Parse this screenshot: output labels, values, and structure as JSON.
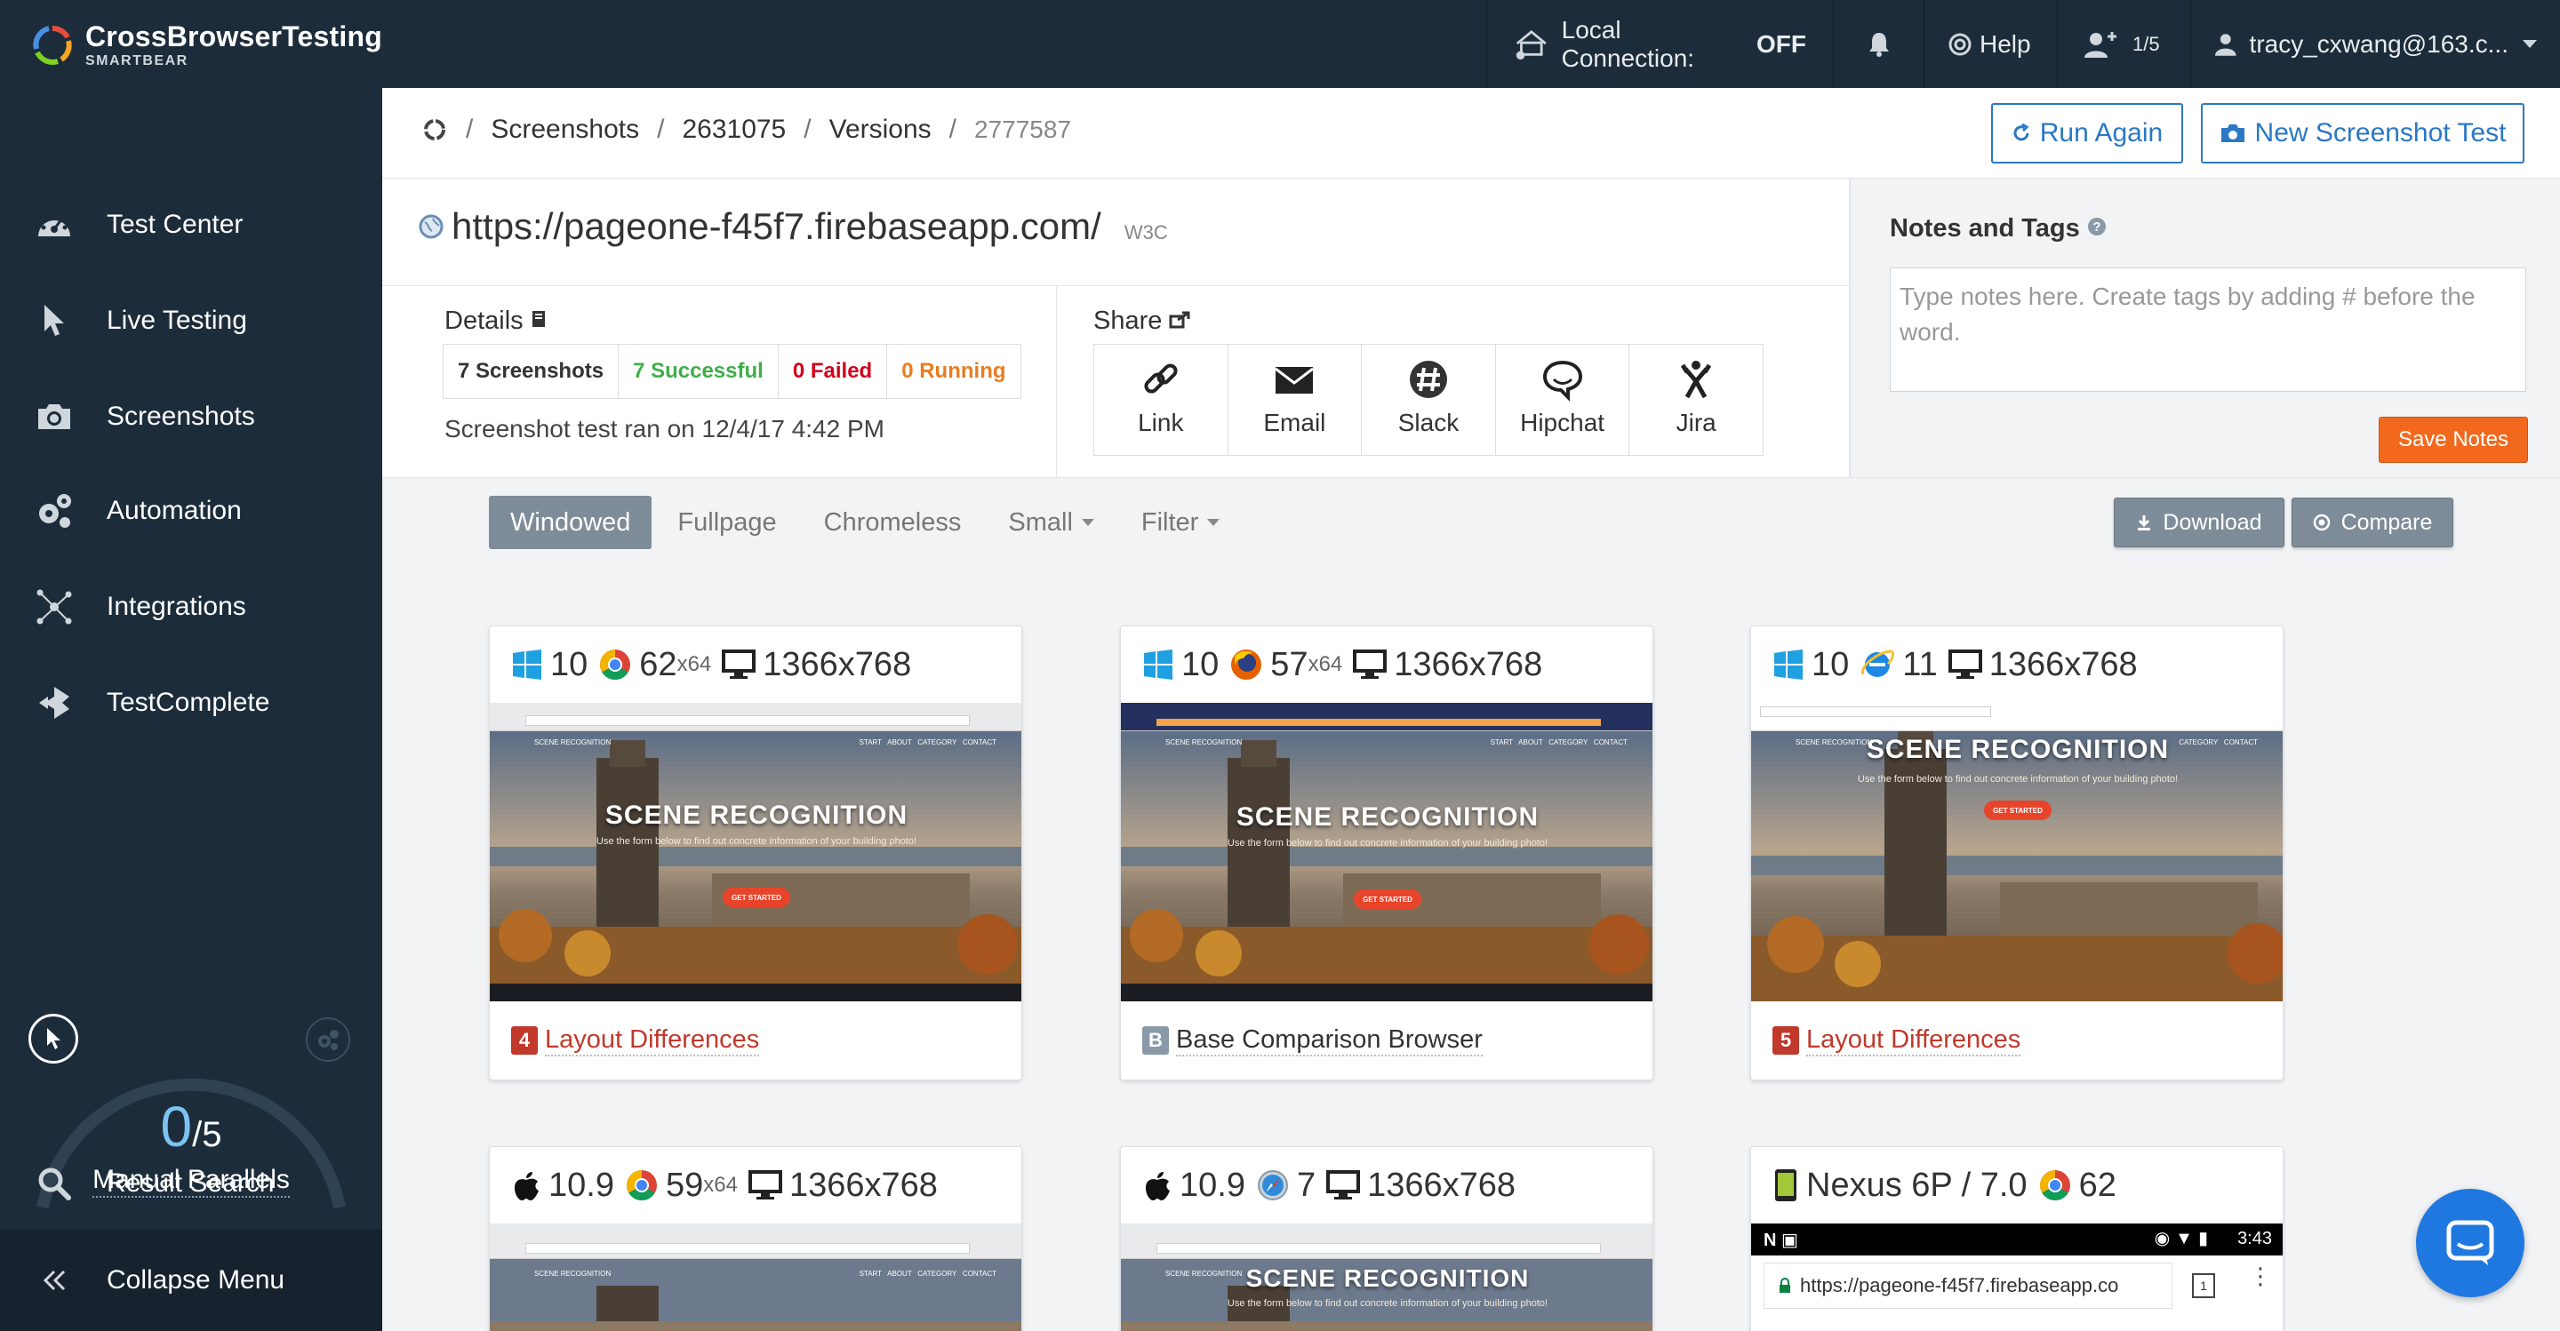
{
  "app": {
    "brand": "CrossBrowserTesting",
    "brand_sub": "SMARTBEAR"
  },
  "topbar": {
    "local_connection_label": "Local Connection:",
    "local_connection_state": "OFF",
    "help_label": "Help",
    "users_count": "1/5",
    "account": "tracy_cxwang@163.c..."
  },
  "sidebar": {
    "items": [
      {
        "label": "Test Center",
        "icon": "dashboard-icon"
      },
      {
        "label": "Live Testing",
        "icon": "cursor-icon"
      },
      {
        "label": "Screenshots",
        "icon": "camera-icon"
      },
      {
        "label": "Automation",
        "icon": "gears-icon"
      },
      {
        "label": "Integrations",
        "icon": "network-icon"
      },
      {
        "label": "TestComplete",
        "icon": "testcomplete-icon"
      }
    ],
    "parallels_used": "0",
    "parallels_total": "/5",
    "parallels_fraction": 0,
    "parallels_label": "Manual Parallels",
    "result_search": "Result Search",
    "collapse": "Collapse Menu"
  },
  "breadcrumb": {
    "items": [
      "Screenshots",
      "2631075",
      "Versions"
    ],
    "current": "2777587"
  },
  "actions": {
    "run_again": "Run Again",
    "new_test": "New Screenshot Test"
  },
  "test": {
    "url": "https://pageone-f45f7.firebaseapp.com/",
    "w3c": "W3C",
    "details_label": "Details",
    "stats": {
      "screenshots": "7 Screenshots",
      "successful": "7 Successful",
      "failed": "0 Failed",
      "running": "0 Running"
    },
    "ran_on": "Screenshot test ran on 12/4/17 4:42 PM",
    "share_label": "Share",
    "share": [
      "Link",
      "Email",
      "Slack",
      "Hipchat",
      "Jira"
    ]
  },
  "notes": {
    "title": "Notes and Tags",
    "placeholder": "Type notes here. Create tags by adding # before the word.",
    "save": "Save Notes"
  },
  "toolbar": {
    "tabs": [
      "Windowed",
      "Fullpage",
      "Chromeless",
      "Small",
      "Filter"
    ],
    "active_tab": "Windowed",
    "download": "Download",
    "compare": "Compare"
  },
  "colors": {
    "nav_bg": "#1d2c3a",
    "primary": "#2b78c4",
    "success": "#3fae49",
    "failed": "#d0021b",
    "running": "#e67e22",
    "save": "#f2691e",
    "layout_diff": "#c0392b"
  },
  "cards": [
    {
      "os_icon": "windows-icon",
      "os": "10",
      "browser_icon": "chrome-icon",
      "browser": "62",
      "arch": "x64",
      "res": "1366x768",
      "badge": "4",
      "result": "Layout Differences",
      "type": "diff"
    },
    {
      "os_icon": "windows-icon",
      "os": "10",
      "browser_icon": "firefox-icon",
      "browser": "57",
      "arch": "x64",
      "res": "1366x768",
      "badge": "B",
      "result": "Base Comparison Browser",
      "type": "base"
    },
    {
      "os_icon": "windows-icon",
      "os": "10",
      "browser_icon": "ie-icon",
      "browser": "11",
      "arch": "",
      "res": "1366x768",
      "badge": "5",
      "result": "Layout Differences",
      "type": "diff"
    },
    {
      "os_icon": "apple-icon",
      "os": "10.9",
      "browser_icon": "chrome-icon",
      "browser": "59",
      "arch": "x64",
      "res": "1366x768"
    },
    {
      "os_icon": "apple-icon",
      "os": "10.9",
      "browser_icon": "safari-icon",
      "browser": "7",
      "arch": "",
      "res": "1366x768"
    },
    {
      "os_icon": "android-phone-icon",
      "os": "Nexus 6P / 7.0",
      "browser_icon": "chrome-icon",
      "browser": "62",
      "arch": "",
      "res": "",
      "mobile_url": "https://pageone-f45f7.firebaseapp.co",
      "mobile_time": "3:43"
    }
  ],
  "screenshot_text": {
    "title": "SCENE RECOGNITION",
    "brand": "SCENE RECOGNITION",
    "cta": "GET STARTED",
    "subtitle": "Use the form below to find out concrete information of your building photo!",
    "nav": [
      "START",
      "ABOUT",
      "CATEGORY",
      "CONTACT"
    ]
  }
}
